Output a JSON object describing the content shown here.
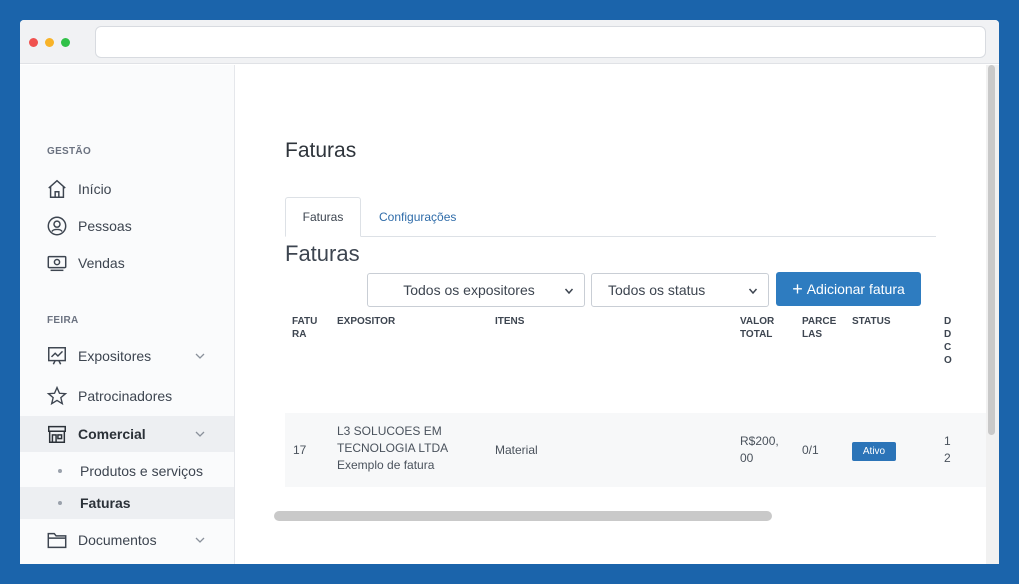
{
  "sidebar": {
    "section_gestao": "GESTÃO",
    "gestao_items": [
      {
        "label": "Início",
        "icon": "home-icon"
      },
      {
        "label": "Pessoas",
        "icon": "person-icon"
      },
      {
        "label": "Vendas",
        "icon": "money-icon"
      }
    ],
    "section_feira": "FEIRA",
    "feira_items": [
      {
        "label": "Expositores",
        "icon": "easel-icon",
        "expandable": true
      },
      {
        "label": "Patrocinadores",
        "icon": "star-icon",
        "expandable": false
      },
      {
        "label": "Comercial",
        "icon": "store-icon",
        "expandable": true,
        "active": true
      }
    ],
    "comercial_sub": [
      {
        "label": "Produtos e serviços"
      },
      {
        "label": "Faturas",
        "active": true
      }
    ],
    "documentos": {
      "label": "Documentos",
      "icon": "folder-icon",
      "expandable": true
    }
  },
  "main": {
    "title": "Faturas",
    "tabs": [
      {
        "label": "Faturas",
        "active": true
      },
      {
        "label": "Configurações",
        "active": false
      }
    ],
    "section_heading": "Faturas",
    "filters": {
      "expositor": "Todos os expositores",
      "status": "Todos os status"
    },
    "add_button": "Adicionar fatura",
    "table": {
      "headers": {
        "fatura": [
          "FATU",
          "RA"
        ],
        "expositor": "EXPOSITOR",
        "itens": "ITENS",
        "valor": [
          "VALOR",
          "TOTAL"
        ],
        "parcelas": [
          "PARCE",
          "LAS"
        ],
        "status": "STATUS",
        "data": [
          "D",
          "D",
          "C",
          "O"
        ]
      },
      "rows": [
        {
          "fatura": "17",
          "expositor": [
            "L3 SOLUCOES EM",
            "TECNOLOGIA LTDA",
            "Exemplo de fatura"
          ],
          "itens": "Material",
          "valor": [
            "R$200,",
            "00"
          ],
          "parcelas": "0/1",
          "status": "Ativo",
          "data": [
            "1",
            "2"
          ]
        }
      ]
    }
  },
  "colors": {
    "frame": "#1b64ab",
    "primary": "#2e7cc0",
    "badge": "#2b74b8",
    "link": "#2f6ca9"
  }
}
